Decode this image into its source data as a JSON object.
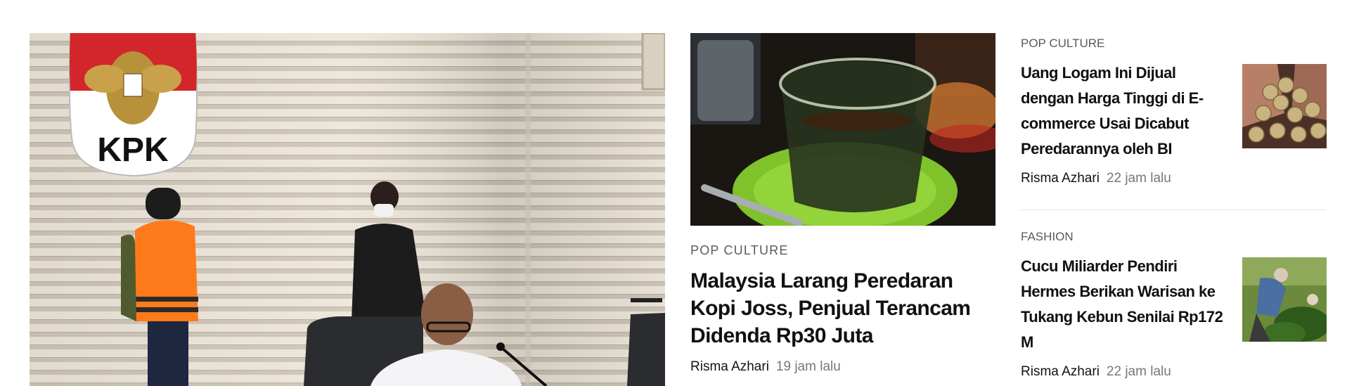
{
  "hero": {
    "image_alt": "KPK press conference",
    "logo_text": "KPK"
  },
  "featured": {
    "image_alt": "Kopi Joss in a glass",
    "category": "POP CULTURE",
    "title": "Malaysia Larang Peredaran Kopi Joss, Penjual Terancam Didenda Rp30 Juta",
    "author": "Risma Azhari",
    "time": "19 jam lalu"
  },
  "side_articles": [
    {
      "category": "POP CULTURE",
      "title": "Uang Logam Ini Dijual dengan Harga Tinggi di E-commerce Usai Dicabut Peredarannya oleh BI",
      "author": "Risma Azhari",
      "time": "22 jam lalu",
      "thumb_alt": "coins in hands"
    },
    {
      "category": "FASHION",
      "title": "Cucu Miliarder Pendiri Hermes Berikan Warisan ke Tukang Kebun Senilai Rp172 M",
      "author": "Risma Azhari",
      "time": "22 jam lalu",
      "thumb_alt": "gardener with plants"
    }
  ],
  "colors": {
    "text": "#111111",
    "muted": "#777777",
    "category": "#5a5a5a",
    "divider": "#e3e3e3"
  }
}
